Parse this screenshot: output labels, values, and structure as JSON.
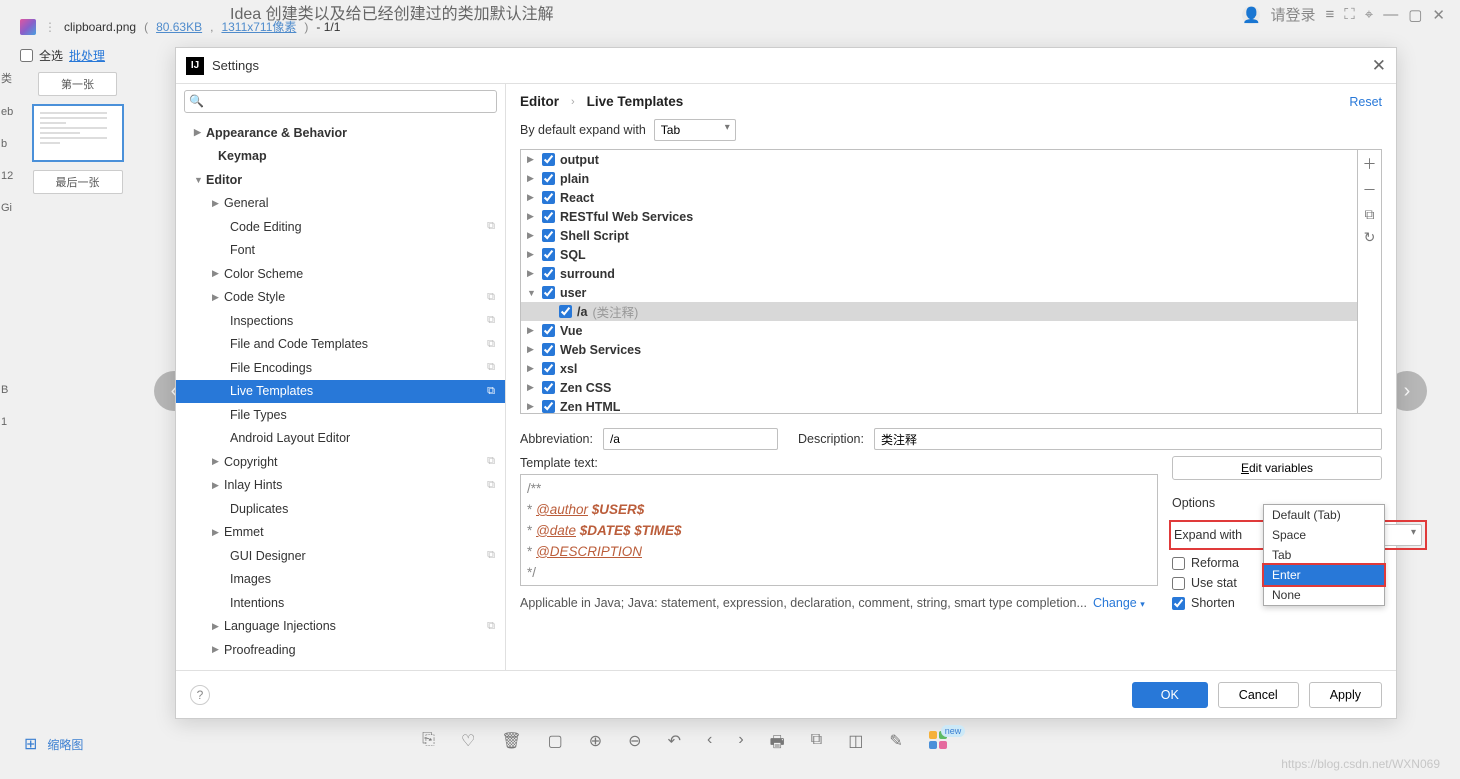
{
  "bgHeaderText": "Idea 创建类以及给已经创建过的类加默认注解",
  "bgRight": {
    "login": "请登录"
  },
  "viewerTitle": {
    "file": "clipboard.png",
    "size": "80.63KB",
    "dims": "1311x711像素",
    "index": "- 1/1"
  },
  "leftPanel": {
    "selectAll": "全选",
    "batch": "批处理",
    "firstTab": "第一张",
    "lastTab": "最后一张"
  },
  "bottomLeft": {
    "thumbIcon": "⊞",
    "thumbLabel": "缩略图"
  },
  "dialog": {
    "title": "Settings",
    "tree": [
      {
        "label": "Appearance & Behavior",
        "level": 1,
        "arrow": "collapsed",
        "bold": true
      },
      {
        "label": "Keymap",
        "level": 1,
        "arrow": "none",
        "bold": true,
        "indent": 30
      },
      {
        "label": "Editor",
        "level": 1,
        "arrow": "expanded",
        "bold": true
      },
      {
        "label": "General",
        "level": 2,
        "arrow": "collapsed"
      },
      {
        "label": "Code Editing",
        "level": 3,
        "arrow": "none",
        "dup": true
      },
      {
        "label": "Font",
        "level": 3,
        "arrow": "none"
      },
      {
        "label": "Color Scheme",
        "level": 2,
        "arrow": "collapsed"
      },
      {
        "label": "Code Style",
        "level": 2,
        "arrow": "collapsed",
        "dup": true
      },
      {
        "label": "Inspections",
        "level": 3,
        "arrow": "none",
        "dup": true
      },
      {
        "label": "File and Code Templates",
        "level": 3,
        "arrow": "none",
        "dup": true
      },
      {
        "label": "File Encodings",
        "level": 3,
        "arrow": "none",
        "dup": true
      },
      {
        "label": "Live Templates",
        "level": 3,
        "arrow": "none",
        "dup": true,
        "selected": true
      },
      {
        "label": "File Types",
        "level": 3,
        "arrow": "none"
      },
      {
        "label": "Android Layout Editor",
        "level": 3,
        "arrow": "none"
      },
      {
        "label": "Copyright",
        "level": 2,
        "arrow": "collapsed",
        "dup": true
      },
      {
        "label": "Inlay Hints",
        "level": 2,
        "arrow": "collapsed",
        "dup": true
      },
      {
        "label": "Duplicates",
        "level": 3,
        "arrow": "none"
      },
      {
        "label": "Emmet",
        "level": 2,
        "arrow": "collapsed"
      },
      {
        "label": "GUI Designer",
        "level": 3,
        "arrow": "none",
        "dup": true
      },
      {
        "label": "Images",
        "level": 3,
        "arrow": "none"
      },
      {
        "label": "Intentions",
        "level": 3,
        "arrow": "none"
      },
      {
        "label": "Language Injections",
        "level": 2,
        "arrow": "collapsed",
        "dup": true
      },
      {
        "label": "Proofreading",
        "level": 2,
        "arrow": "collapsed"
      }
    ],
    "breadcrumb": {
      "a": "Editor",
      "b": "Live Templates",
      "reset": "Reset"
    },
    "defaultExpandLabel": "By default expand with",
    "defaultExpandValue": "Tab",
    "templateGroups": [
      {
        "name": "output",
        "arrow": "collapsed"
      },
      {
        "name": "plain",
        "arrow": "collapsed"
      },
      {
        "name": "React",
        "arrow": "collapsed"
      },
      {
        "name": "RESTful Web Services",
        "arrow": "collapsed"
      },
      {
        "name": "Shell Script",
        "arrow": "collapsed"
      },
      {
        "name": "SQL",
        "arrow": "collapsed"
      },
      {
        "name": "surround",
        "arrow": "collapsed"
      },
      {
        "name": "user",
        "arrow": "expanded",
        "children": [
          {
            "key": "/a",
            "hint": "(类注释)",
            "selected": true
          }
        ]
      },
      {
        "name": "Vue",
        "arrow": "collapsed"
      },
      {
        "name": "Web Services",
        "arrow": "collapsed"
      },
      {
        "name": "xsl",
        "arrow": "collapsed"
      },
      {
        "name": "Zen CSS",
        "arrow": "collapsed"
      },
      {
        "name": "Zen HTML",
        "arrow": "collapsed"
      }
    ],
    "abbrevLabel": "Abbreviation:",
    "abbrevValue": "/a",
    "descLabel": "Description:",
    "descValue": "类注释",
    "templateTextLabel": "Template text:",
    "templateCode": {
      "l1": "/**",
      "l2a": " * ",
      "l2k": "@author",
      "l2v": " $USER$",
      "l3a": " * ",
      "l3k": "@date",
      "l3v": " $DATE$ $TIME$",
      "l4a": " * ",
      "l4k": "@DESCRIPTION",
      "l5": " */"
    },
    "editVars": "Edit variables",
    "optionsTitle": "Options",
    "expandWithLabel": "Expand with",
    "expandWithValue": "Default (Tab)",
    "opts": {
      "reformat": "Reforma",
      "useStatic": "Use stat",
      "shorten": "Shorten"
    },
    "dropdown": [
      "Default (Tab)",
      "Space",
      "Tab",
      "Enter",
      "None"
    ],
    "applicable": "Applicable in Java; Java: statement, expression, declaration, comment, string, smart type completion...",
    "changeLink": "Change",
    "footer": {
      "ok": "OK",
      "cancel": "Cancel",
      "apply": "Apply"
    }
  },
  "newBadge": "new"
}
